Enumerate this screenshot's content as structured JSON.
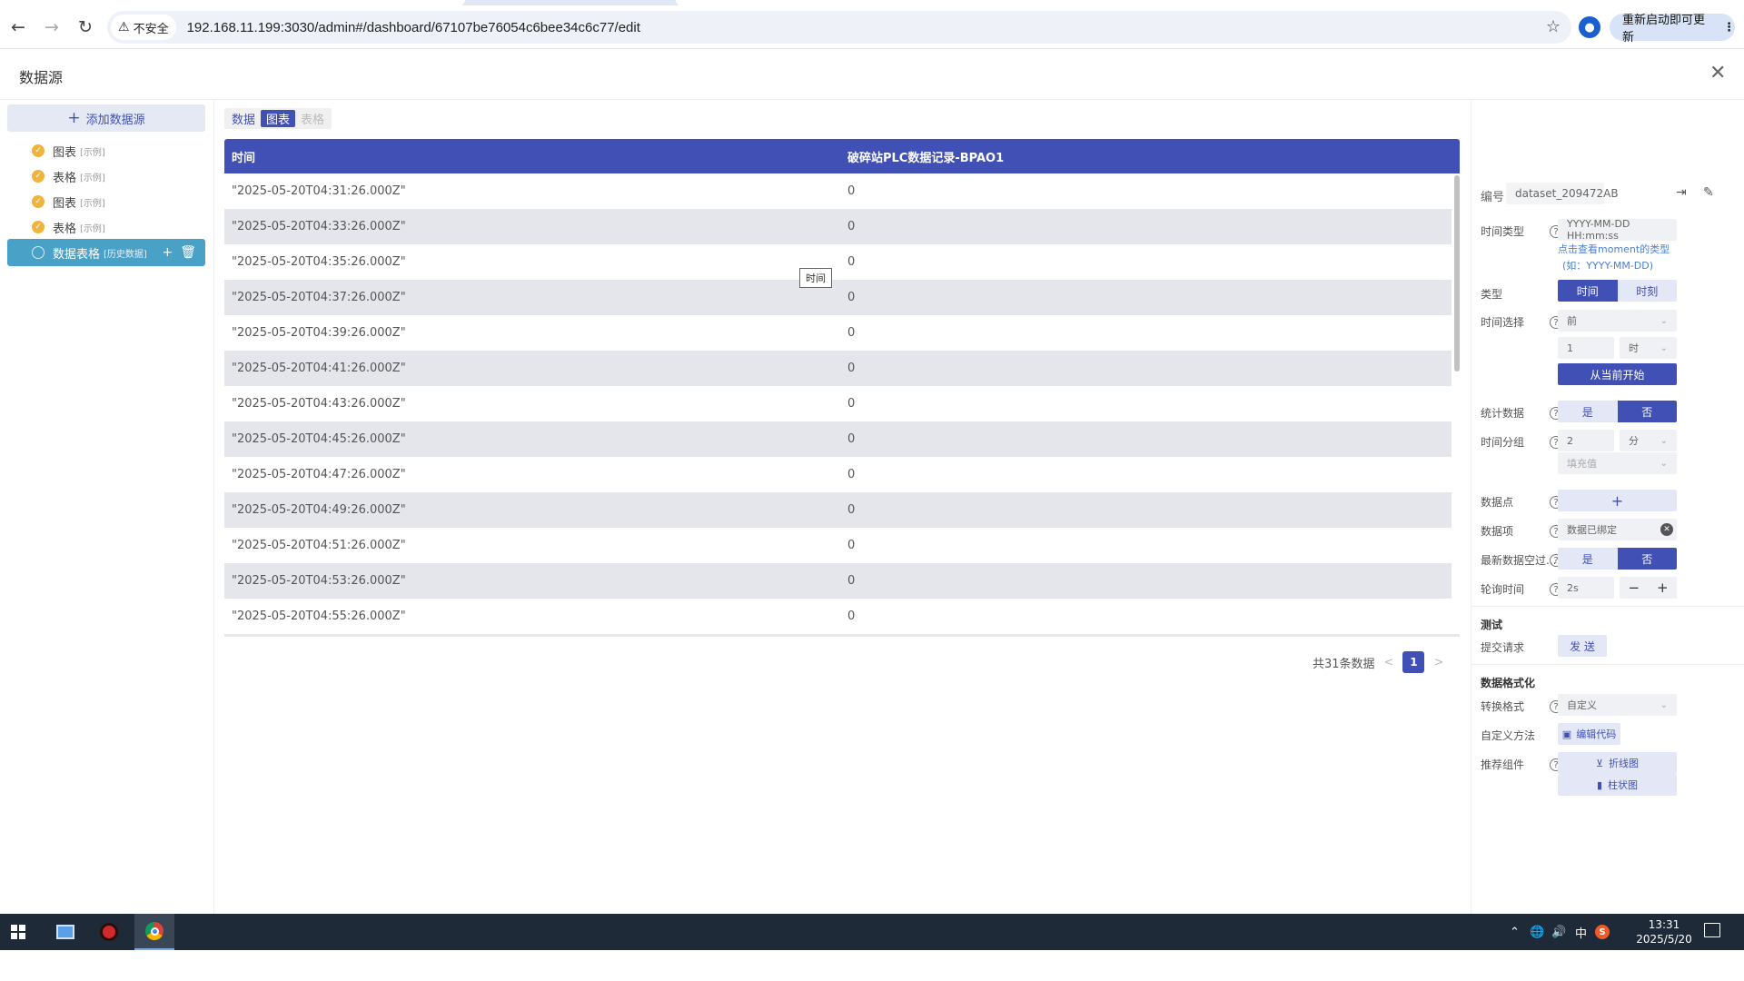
{
  "browser": {
    "security_label": "不安全",
    "url": "192.168.11.199:3030/admin#/dashboard/67107be76054c6bee34c6c77/edit",
    "update_label": "重新启动即可更新"
  },
  "page": {
    "title": "数据源"
  },
  "sidebar": {
    "add_label": "添加数据源",
    "items": [
      {
        "label": "图表",
        "tag": "[示例]"
      },
      {
        "label": "表格",
        "tag": "[示例]"
      },
      {
        "label": "图表",
        "tag": "[示例]"
      },
      {
        "label": "表格",
        "tag": "[示例]"
      },
      {
        "label": "数据表格",
        "tag": "[历史数据]"
      }
    ]
  },
  "content": {
    "tabs": [
      "数据",
      "图表",
      "表格"
    ],
    "columns": [
      "时间",
      "破碎站PLC数据记录-BPAO1"
    ],
    "tooltip": "时间",
    "rows": [
      {
        "time": "\"2025-05-20T04:31:26.000Z\"",
        "value": "0"
      },
      {
        "time": "\"2025-05-20T04:33:26.000Z\"",
        "value": "0"
      },
      {
        "time": "\"2025-05-20T04:35:26.000Z\"",
        "value": "0"
      },
      {
        "time": "\"2025-05-20T04:37:26.000Z\"",
        "value": "0"
      },
      {
        "time": "\"2025-05-20T04:39:26.000Z\"",
        "value": "0"
      },
      {
        "time": "\"2025-05-20T04:41:26.000Z\"",
        "value": "0"
      },
      {
        "time": "\"2025-05-20T04:43:26.000Z\"",
        "value": "0"
      },
      {
        "time": "\"2025-05-20T04:45:26.000Z\"",
        "value": "0"
      },
      {
        "time": "\"2025-05-20T04:47:26.000Z\"",
        "value": "0"
      },
      {
        "time": "\"2025-05-20T04:49:26.000Z\"",
        "value": "0"
      },
      {
        "time": "\"2025-05-20T04:51:26.000Z\"",
        "value": "0"
      },
      {
        "time": "\"2025-05-20T04:53:26.000Z\"",
        "value": "0"
      },
      {
        "time": "\"2025-05-20T04:55:26.000Z\"",
        "value": "0"
      }
    ],
    "pager": {
      "total": "共31条数据",
      "current": "1"
    }
  },
  "panel": {
    "id_label": "编号",
    "id_value": "dataset_209472AB",
    "time_type_label": "时间类型",
    "time_type_value": "YYYY-MM-DD HH:mm:ss",
    "moment_link": "点击查看moment的类型",
    "moment_example": "(如：YYYY-MM-DD)",
    "type_label": "类型",
    "type_options": [
      "时间",
      "时刻"
    ],
    "time_select_label": "时间选择",
    "time_select_value": "前",
    "time_amount": "1",
    "time_unit": "时",
    "from_now_label": "从当前开始",
    "stat_label": "统计数据",
    "yes": "是",
    "no": "否",
    "group_label": "时间分组",
    "group_amount": "2",
    "group_unit": "分",
    "fill_placeholder": "填充值",
    "point_label": "数据点",
    "item_label": "数据项",
    "item_value": "数据已绑定",
    "latest_label": "最新数据空过...",
    "poll_label": "轮询时间",
    "poll_value": "2s",
    "test_title": "测试",
    "submit_label": "提交请求",
    "send_label": "发 送",
    "format_title": "数据格式化",
    "convert_label": "转换格式",
    "convert_value": "自定义",
    "custom_label": "自定义方法",
    "edit_code_label": "编辑代码",
    "recommend_label": "推荐组件",
    "line_chart_label": "折线图",
    "bar_chart_label": "柱状图"
  },
  "taskbar": {
    "time": "13:31",
    "date": "2025/5/20",
    "ime": "中"
  },
  "colors": {
    "primary": "#4050b5",
    "active_item": "#4aa1c8",
    "orange": "#f0b33c"
  }
}
